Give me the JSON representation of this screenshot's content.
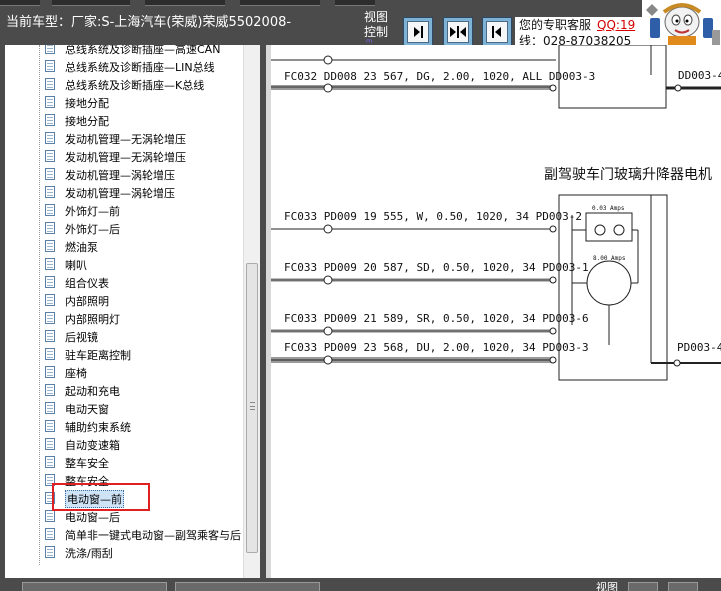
{
  "header": {
    "car_label": "当前车型：厂家:S-上海汽车(荣威)荣威5502008-",
    "view_label_line1": "视图",
    "view_label_line2": "控制",
    "view_tick": "ᵐ",
    "support_line1": "您的专职客服",
    "support_qq": "QQ:19",
    "support_line2": "线：028-87038205"
  },
  "nav_buttons": [
    {
      "name": "nav-next-button",
      "icon": "arrow-right-icon"
    },
    {
      "name": "nav-expand-button",
      "icon": "arrows-in-icon"
    },
    {
      "name": "nav-prev-button",
      "icon": "arrow-left-icon"
    }
  ],
  "tree": {
    "items": [
      {
        "label": "总线系统及诊断插座—高速CAN"
      },
      {
        "label": "总线系统及诊断插座—LIN总线"
      },
      {
        "label": "总线系统及诊断插座—K总线"
      },
      {
        "label": "接地分配"
      },
      {
        "label": "接地分配"
      },
      {
        "label": "发动机管理—无涡轮增压"
      },
      {
        "label": "发动机管理—无涡轮增压"
      },
      {
        "label": "发动机管理—涡轮增压"
      },
      {
        "label": "发动机管理—涡轮增压"
      },
      {
        "label": "外饰灯—前"
      },
      {
        "label": "外饰灯—后"
      },
      {
        "label": "燃油泵"
      },
      {
        "label": "喇叭"
      },
      {
        "label": "组合仪表"
      },
      {
        "label": "内部照明"
      },
      {
        "label": "内部照明灯"
      },
      {
        "label": "后视镜"
      },
      {
        "label": "驻车距离控制"
      },
      {
        "label": "座椅"
      },
      {
        "label": "起动和充电"
      },
      {
        "label": "电动天窗"
      },
      {
        "label": "辅助约束系统"
      },
      {
        "label": "自动变速箱"
      },
      {
        "label": "整车安全"
      },
      {
        "label": "整车安全"
      },
      {
        "label": "电动窗—前",
        "selected": true
      },
      {
        "label": "电动窗—后"
      },
      {
        "label": "简单非一键式电动窗—副驾乘客与后"
      },
      {
        "label": "洗涤/雨刮"
      }
    ]
  },
  "diagram": {
    "title": "副驾驶车门玻璃升降器电机",
    "wires": [
      {
        "text": "FC032 DD008 23 567, DG, 2.00, 1020, ALL DD003-3"
      },
      {
        "text": "FC033 PD009 19 555, W, 0.50, 1020, 34  PD003-2"
      },
      {
        "text": "FC033 PD009 20 587, SD, 0.50, 1020, 34  PD003-1"
      },
      {
        "text": "FC033 PD009 21 589, SR, 0.50, 1020, 34  PD003-6"
      },
      {
        "text": "FC033 PD009 23 568, DU, 2.00, 1020, 34  PD003-3"
      }
    ],
    "right_labels": {
      "top": "DD003-4",
      "bottom": "PD003-4"
    },
    "fuse_label": "0.03 Amps",
    "motor_label": "8.00 Amps"
  },
  "footer": {
    "view_label": "视图"
  },
  "colors": {
    "chrome": "#4b4b4b",
    "selection_box": "#e02020",
    "qq_link": "#d40000",
    "nav_button": "#7fb3d6"
  }
}
